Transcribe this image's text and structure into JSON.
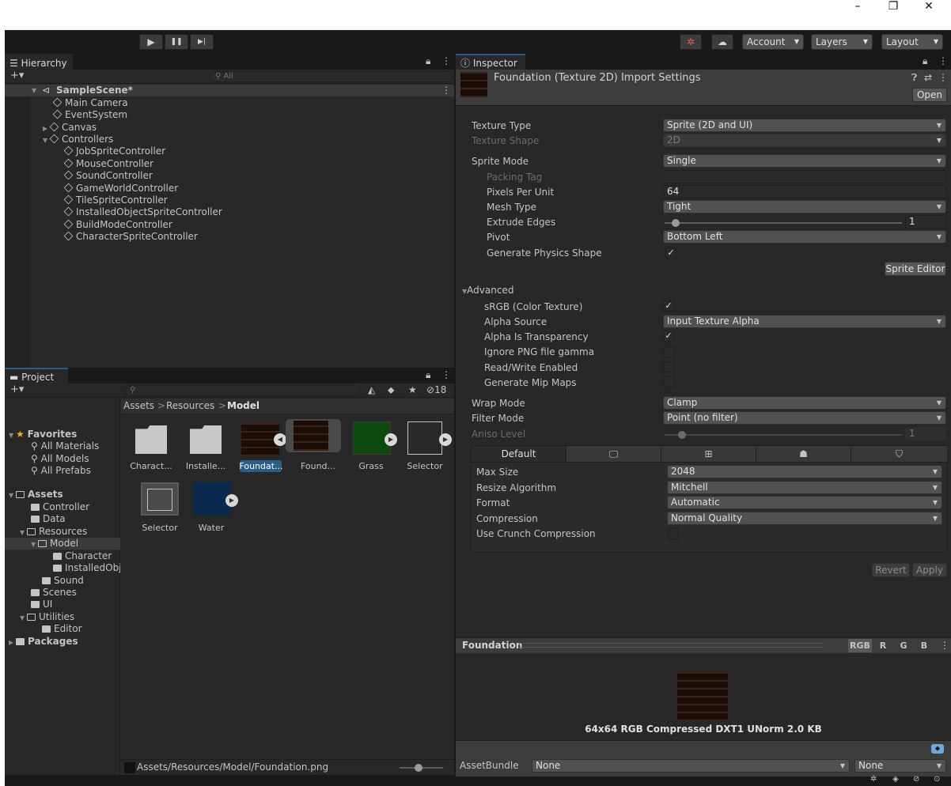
{
  "window": {
    "minimize_glyph": "–",
    "maximize_glyph": "❐",
    "close_glyph": "✕"
  },
  "toolbar": {
    "play_glyph": "▶",
    "pause_glyph": "❚❚",
    "step_glyph": "▶|",
    "account_label": "Account",
    "layers_label": "Layers",
    "layout_label": "Layout",
    "dropdown_arrow": "▼"
  },
  "hierarchy": {
    "tab_label": "Hierarchy",
    "search_placeholder": "All",
    "scene_name": "SampleScene*",
    "items": [
      {
        "label": "Main Camera"
      },
      {
        "label": "EventSystem"
      },
      {
        "label": "Canvas"
      },
      {
        "label": "Controllers"
      },
      {
        "label": "JobSpriteController"
      },
      {
        "label": "MouseController"
      },
      {
        "label": "SoundController"
      },
      {
        "label": "GameWorldController"
      },
      {
        "label": "TileSpriteController"
      },
      {
        "label": "InstalledObjectSpriteController"
      },
      {
        "label": "BuildModeController"
      },
      {
        "label": "CharacterSpriteController"
      }
    ]
  },
  "project": {
    "tab_label": "Project",
    "hidden_count": "18",
    "breadcrumb": [
      "Assets",
      "Resources",
      "Model"
    ],
    "tree": [
      {
        "label": "Favorites"
      },
      {
        "label": "All Materials"
      },
      {
        "label": "All Models"
      },
      {
        "label": "All Prefabs"
      },
      {
        "label": "Assets"
      },
      {
        "label": "Controller"
      },
      {
        "label": "Data"
      },
      {
        "label": "Resources"
      },
      {
        "label": "Model"
      },
      {
        "label": "Character"
      },
      {
        "label": "InstalledObje"
      },
      {
        "label": "Sound"
      },
      {
        "label": "Scenes"
      },
      {
        "label": "UI"
      },
      {
        "label": "Utilities"
      },
      {
        "label": "Editor"
      },
      {
        "label": "Packages"
      }
    ],
    "assets": [
      {
        "label": "Charact..."
      },
      {
        "label": "Installe..."
      },
      {
        "label": "Foundat..."
      },
      {
        "label": "Found..."
      },
      {
        "label": "Grass"
      },
      {
        "label": "Selector"
      },
      {
        "label": "Selector"
      },
      {
        "label": "Water"
      }
    ],
    "status_path": "Assets/Resources/Model/Foundation.png"
  },
  "inspector": {
    "tab_label": "Inspector",
    "title": "Foundation (Texture 2D) Import Settings",
    "open_button": "Open",
    "texture_type_label": "Texture Type",
    "texture_type_value": "Sprite (2D and UI)",
    "texture_shape_label": "Texture Shape",
    "texture_shape_value": "2D",
    "sprite_mode_label": "Sprite Mode",
    "sprite_mode_value": "Single",
    "packing_tag_label": "Packing Tag",
    "ppu_label": "Pixels Per Unit",
    "ppu_value": "64",
    "mesh_type_label": "Mesh Type",
    "mesh_type_value": "Tight",
    "extrude_label": "Extrude Edges",
    "extrude_value": "1",
    "pivot_label": "Pivot",
    "pivot_value": "Bottom Left",
    "physics_shape_label": "Generate Physics Shape",
    "sprite_editor_button": "Sprite Editor",
    "advanced_label": "Advanced",
    "srgb_label": "sRGB (Color Texture)",
    "alpha_source_label": "Alpha Source",
    "alpha_source_value": "Input Texture Alpha",
    "alpha_transparency_label": "Alpha Is Transparency",
    "ignore_png_label": "Ignore PNG file gamma",
    "read_write_label": "Read/Write Enabled",
    "mipmaps_label": "Generate Mip Maps",
    "wrap_label": "Wrap Mode",
    "wrap_value": "Clamp",
    "filter_label": "Filter Mode",
    "filter_value": "Point (no filter)",
    "aniso_label": "Aniso Level",
    "aniso_value": "1",
    "platform_default_tab": "Default",
    "max_size_label": "Max Size",
    "max_size_value": "2048",
    "resize_label": "Resize Algorithm",
    "resize_value": "Mitchell",
    "format_label": "Format",
    "format_value": "Automatic",
    "compression_label": "Compression",
    "compression_value": "Normal Quality",
    "crunch_label": "Use Crunch Compression",
    "revert_button": "Revert",
    "apply_button": "Apply",
    "check_glyph": "✓"
  },
  "preview": {
    "title": "Foundation",
    "channels": [
      "RGB",
      "R",
      "G",
      "B"
    ],
    "info": "64x64  RGB Compressed DXT1 UNorm  2.0 KB"
  },
  "assetbundle": {
    "label": "AssetBundle",
    "name_value": "None",
    "variant_value": "None"
  },
  "colors": {
    "accent": "#2c5d87",
    "panel": "#282828",
    "field": "#515151",
    "grass": "#0e4a0e",
    "water": "#0b2a4e"
  }
}
